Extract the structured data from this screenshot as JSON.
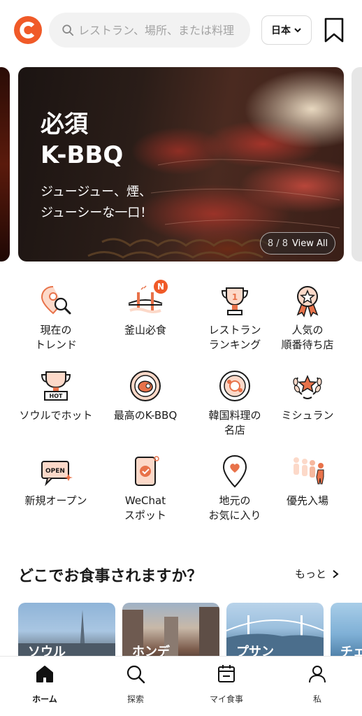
{
  "header": {
    "logo": "catch-table-logo",
    "search_placeholder": "レストラン、場所、または料理",
    "language_label": "日本",
    "brand_color": "#f05a28"
  },
  "banner": {
    "title": "必須\nK-BBQ",
    "subtitle": "ジュージュー、煙、\nジューシーな一口！",
    "pager_count": "8 / 8",
    "pager_action": "View All"
  },
  "categories": [
    {
      "label": "現在の\nトレンド",
      "icon": "trend-search-icon"
    },
    {
      "label": "釜山必食",
      "icon": "bridge-icon",
      "badge": "N"
    },
    {
      "label": "レストラン\nランキング",
      "icon": "trophy-icon"
    },
    {
      "label": "人気の\n順番待ち店",
      "icon": "award-ribbon-icon"
    },
    {
      "label": "ソウルでホット",
      "icon": "hot-trophy-icon"
    },
    {
      "label": "最高のK-BBQ",
      "icon": "meat-plate-icon"
    },
    {
      "label": "韓国料理の\n名店",
      "icon": "bowl-icon"
    },
    {
      "label": "ミシュラン",
      "icon": "laurel-star-icon"
    },
    {
      "label": "新規オープン",
      "icon": "open-sign-icon"
    },
    {
      "label": "WeChat\nスポット",
      "icon": "wechat-phone-icon"
    },
    {
      "label": "地元の\nお気に入り",
      "icon": "heart-pin-icon"
    },
    {
      "label": "優先入場",
      "icon": "queue-people-icon"
    }
  ],
  "where_section": {
    "title": "どこでお食事されますか？",
    "more_label": "もっと"
  },
  "cities": [
    {
      "name": "ソウル"
    },
    {
      "name": "ホンデ"
    },
    {
      "name": "プサン"
    },
    {
      "name": "チェ"
    }
  ],
  "bottom_nav": [
    {
      "label": "ホーム",
      "icon": "home-icon",
      "active": true
    },
    {
      "label": "探索",
      "icon": "search-icon"
    },
    {
      "label": "マイ食事",
      "icon": "calendar-icon"
    },
    {
      "label": "私",
      "icon": "user-icon"
    }
  ]
}
